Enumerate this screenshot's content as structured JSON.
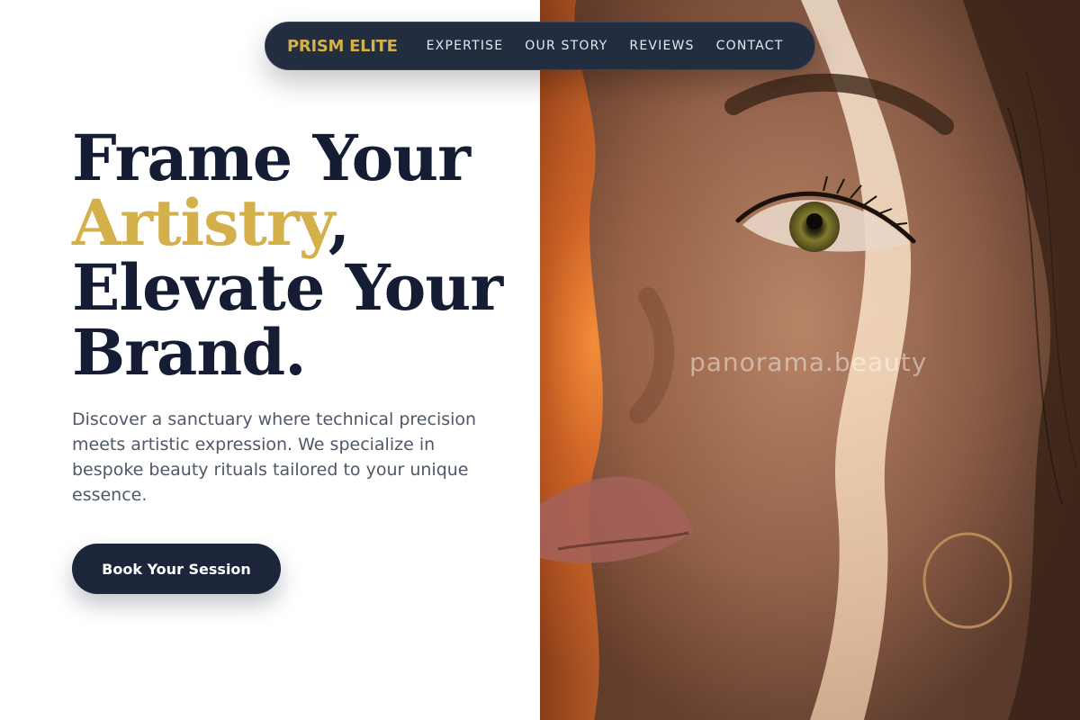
{
  "nav": {
    "brand": "PRISM ELITE",
    "links": [
      "EXPERTISE",
      "OUR STORY",
      "REVIEWS",
      "CONTACT"
    ]
  },
  "hero": {
    "headline_line1": "Frame Your",
    "headline_accent": "Artistry",
    "headline_comma": ",",
    "headline_line3": "Elevate Your",
    "headline_line4": "Brand.",
    "description": "Discover a sanctuary where technical precision meets artistic expression. We specialize in bespoke beauty rituals tailored to your unique essence.",
    "cta_label": "Book Your Session"
  },
  "photo": {
    "watermark": "panorama.beauty"
  },
  "colors": {
    "navy": "#1c2539",
    "gold": "#d4b04a",
    "text_gray": "#4f5866"
  }
}
